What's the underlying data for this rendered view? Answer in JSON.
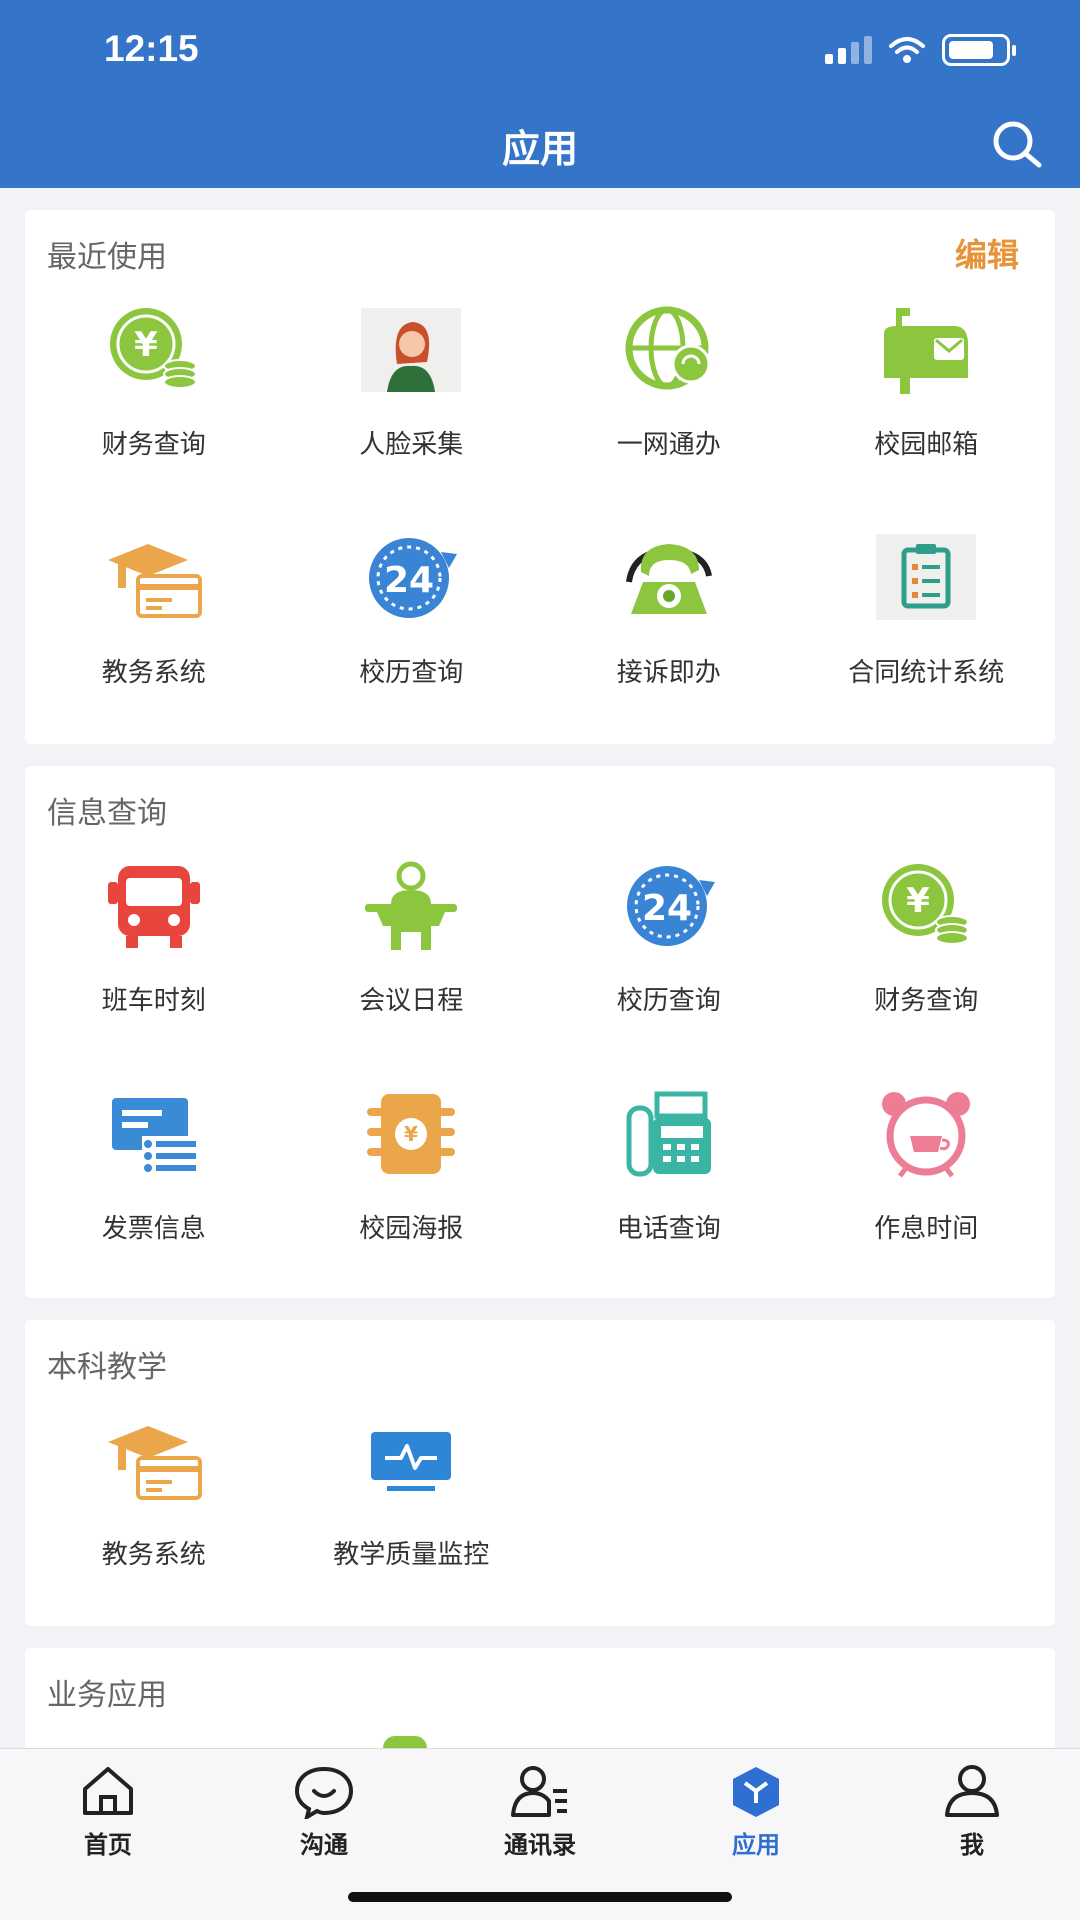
{
  "status": {
    "time": "12:15"
  },
  "header": {
    "title": "应用"
  },
  "sections": [
    {
      "title": "最近使用",
      "action": "编辑",
      "items": [
        {
          "label": "财务查询",
          "icon": "finance-yuan-icon"
        },
        {
          "label": "人脸采集",
          "icon": "face-capture-icon"
        },
        {
          "label": "一网通办",
          "icon": "globe-service-icon"
        },
        {
          "label": "校园邮箱",
          "icon": "mailbox-icon"
        },
        {
          "label": "教务系统",
          "icon": "academic-cap-icon"
        },
        {
          "label": "校历查询",
          "icon": "calendar-24-icon"
        },
        {
          "label": "接诉即办",
          "icon": "telephone-icon"
        },
        {
          "label": "合同统计系统",
          "icon": "clipboard-checklist-icon"
        }
      ]
    },
    {
      "title": "信息查询",
      "items": [
        {
          "label": "班车时刻",
          "icon": "bus-icon"
        },
        {
          "label": "会议日程",
          "icon": "meeting-speaker-icon"
        },
        {
          "label": "校历查询",
          "icon": "calendar-24-icon"
        },
        {
          "label": "财务查询",
          "icon": "finance-yuan-icon"
        },
        {
          "label": "发票信息",
          "icon": "invoice-list-icon"
        },
        {
          "label": "校园海报",
          "icon": "poster-icon"
        },
        {
          "label": "电话查询",
          "icon": "fax-phone-icon"
        },
        {
          "label": "作息时间",
          "icon": "alarm-clock-icon"
        }
      ]
    },
    {
      "title": "本科教学",
      "items": [
        {
          "label": "教务系统",
          "icon": "academic-cap-icon"
        },
        {
          "label": "教学质量监控",
          "icon": "monitor-pulse-icon"
        }
      ]
    },
    {
      "title": "业务应用",
      "items": []
    }
  ],
  "tabbar": [
    {
      "label": "首页",
      "icon": "home-icon",
      "active": false
    },
    {
      "label": "沟通",
      "icon": "chat-icon",
      "active": false
    },
    {
      "label": "通讯录",
      "icon": "contacts-icon",
      "active": false
    },
    {
      "label": "应用",
      "icon": "apps-cube-icon",
      "active": true
    },
    {
      "label": "我",
      "icon": "user-icon",
      "active": false
    }
  ],
  "colors": {
    "header": "#3575c9",
    "accent": "#e8933a",
    "active_tab": "#2f6fd1"
  }
}
